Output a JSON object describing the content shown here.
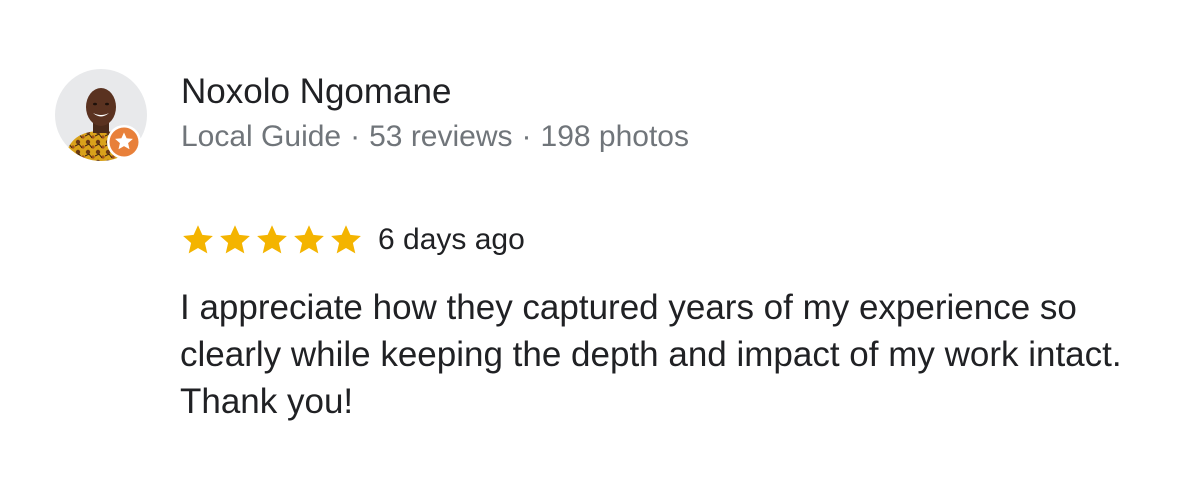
{
  "reviewer": {
    "name": "Noxolo Ngomane",
    "level": "Local Guide",
    "separator": "·",
    "reviews": "53 reviews",
    "photos": "198 photos"
  },
  "review": {
    "rating": 5,
    "max_rating": 5,
    "date": "6 days ago",
    "text": "I appreciate how they captured years of my experience so clearly while keeping the depth and impact of my work intact. Thank you!"
  },
  "icons": {
    "avatar": "avatar-photo",
    "badge": "local-guide-badge-icon",
    "star": "star-icon"
  },
  "colors": {
    "star": "#f4b400",
    "badge": "#e8803a",
    "meta_text": "#70757a",
    "primary_text": "#202124"
  }
}
